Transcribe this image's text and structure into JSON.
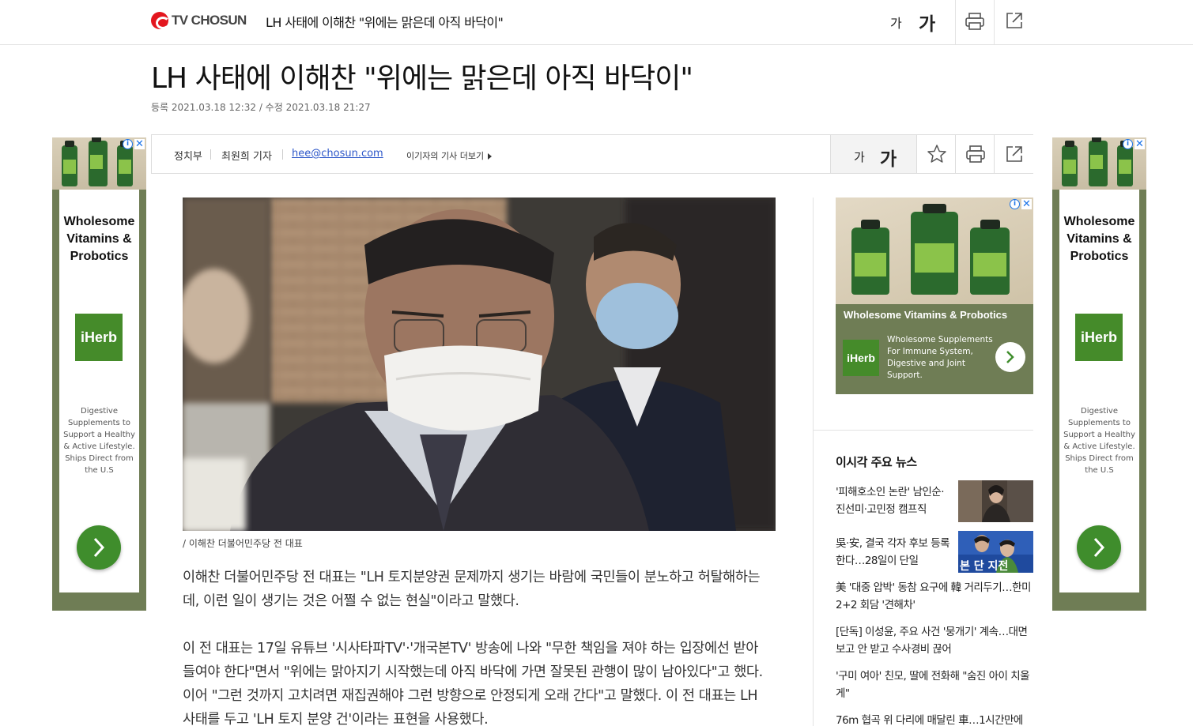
{
  "header": {
    "logo_text": "TV CHOSUN",
    "title": "LH 사태에 이해찬 \"위에는 맑은데 아직 바닥이\"",
    "font_small": "가",
    "font_large": "가"
  },
  "article": {
    "headline": "LH 사태에 이해찬 \"위에는 맑은데 아직 바닥이\"",
    "dates": "등록 2021.03.18 12:32 / 수정 2021.03.18 21:27",
    "section": "정치부",
    "reporter": "최원희 기자",
    "email": "hee@chosun.com",
    "more_articles": "이기자의 기사 더보기",
    "font_small": "가",
    "font_large": "가",
    "photo_caption": "/ 이해찬 더불어민주당 전 대표",
    "paragraphs": [
      "이해찬 더불어민주당 전 대표는 \"LH 토지분양권 문제까지 생기는 바람에 국민들이 분노하고 허탈해하는데, 이런 일이 생기는 것은 어쩔 수 없는 현실\"이라고 말했다.",
      "이 전 대표는 17일 유튜브 '시사타파TV'·'개국본TV' 방송에 나와 \"무한 책임을 져야 하는 입장에선 받아들여야 한다\"면서 \"위에는 맑아지기 시작했는데 아직 바닥에 가면 잘못된 관행이 많이 남아있다\"고 했다. 이어 \"그런 것까지 고치려면 재집권해야 그런 방향으로 안정되게 오래 간다\"고 말했다. 이 전 대표는 LH 사태를 두고 'LH 토지 분양 건'이라는 표현을 사용했다."
    ]
  },
  "ads": {
    "side_title": "Wholesome Vitamins & Probotics",
    "brand": "iHerb",
    "side_desc": "Digestive Supplements to Support a Healthy & Active Lifestyle. Ships Direct from the U.S",
    "mid_title": "Wholesome Vitamins & Probotics",
    "mid_desc": "Wholesome Supplements For Immune System, Digestive and Joint Support.",
    "info_icon": "i",
    "close_icon": "✕",
    "accent": "#6f7d55",
    "brand_color": "#458b2a"
  },
  "news": {
    "heading": "이시각 주요 뉴스",
    "items": [
      "'피해호소인 논란' 남인순·진선미·고민정 캠프직",
      "吳·安, 결국 각자 후보 등록한다…28일이 단일",
      "美 '대중 압박' 동참 요구에 韓 거리두기…한미 2+2 회담 '견해차'",
      "[단독] 이성윤, 주요 사건 '뭉개기' 계속…대면보고 안 받고 수사경비 끊어",
      "'구미 여아' 친모, 딸에 전화해 \"숨진 아이 치울게\"",
      "76m 협곡 위 다리에 매달린 車…1시간만에"
    ],
    "thumb2_text": "본 단 지전"
  },
  "colors": {
    "brand_red": "#e3161e",
    "link_blue": "#2d57c9"
  }
}
